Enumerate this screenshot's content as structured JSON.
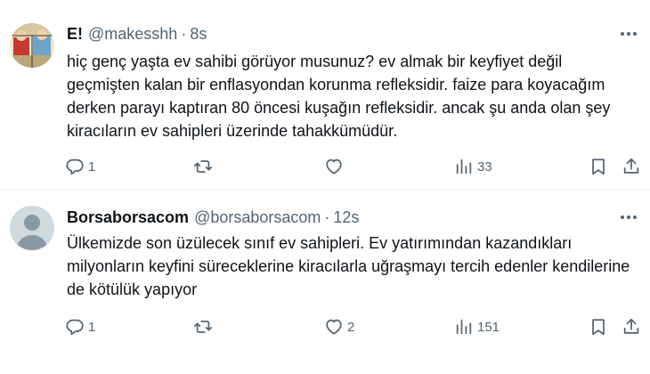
{
  "tweets": [
    {
      "display_name": "E!",
      "handle": "@makesshh",
      "separator": "·",
      "time": "8s",
      "text": "hiç genç yaşta ev sahibi görüyor musunuz? ev almak bir keyfiyet değil geçmişten kalan bir enflasyondan korunma refleksidir. faize para koyacağım derken parayı kaptıran 80 öncesi kuşağın refleksidir. ancak şu anda olan şey kiracıların ev sahipleri üzerinde tahakkümüdür.",
      "avatar_icon": "cartoon-avatar-icon",
      "actions": {
        "replies": "1",
        "reposts": "",
        "likes": "",
        "views": "33"
      }
    },
    {
      "display_name": "Borsaborsacom",
      "handle": "@borsaborsacom",
      "separator": "·",
      "time": "12s",
      "text": "Ülkemizde son üzülecek sınıf ev sahipleri. Ev yatırımından kazandıkları milyonların keyfini süreceklerine kiracılarla uğraşmayı tercih edenler kendilerine de kötülük yapıyor",
      "avatar_icon": "default-profile-icon",
      "actions": {
        "replies": "1",
        "reposts": "",
        "likes": "2",
        "views": "151"
      }
    }
  ],
  "icons": [
    "reply-icon",
    "repost-icon",
    "like-icon",
    "views-icon",
    "bookmark-icon",
    "share-icon",
    "more-icon"
  ],
  "colors": {
    "text": "#0f1419",
    "secondary": "#536471",
    "divider": "#eff3f4",
    "background": "#ffffff"
  }
}
